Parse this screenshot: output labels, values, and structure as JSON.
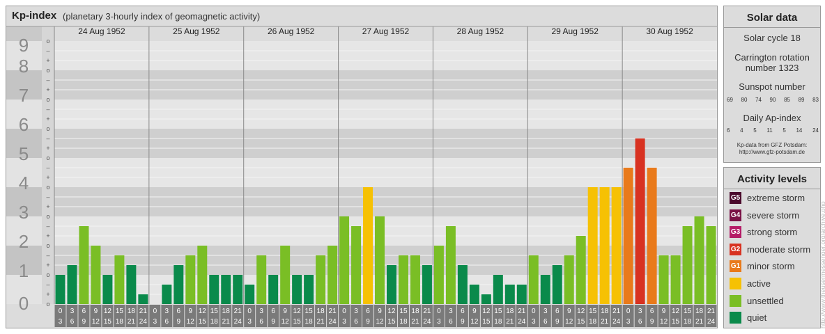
{
  "header": {
    "title": "Kp-index",
    "subtitle": "(planetary 3-hourly index of geomagnetic activity)"
  },
  "chart_data": {
    "type": "bar",
    "title": "Kp-index",
    "subtitle": "(planetary 3-hourly index of geomagnetic activity)",
    "ylim": [
      0,
      9
    ],
    "y_ticks": [
      "0",
      "1",
      "2",
      "3",
      "4",
      "5",
      "6",
      "7",
      "8",
      "9"
    ],
    "minor_tick_labels": [
      "o",
      "+",
      "–"
    ],
    "days": [
      "24 Aug 1952",
      "25 Aug 1952",
      "26 Aug 1952",
      "27 Aug 1952",
      "28 Aug 1952",
      "29 Aug 1952",
      "30 Aug 1952"
    ],
    "interval_labels": [
      [
        "0",
        "3"
      ],
      [
        "3",
        "6"
      ],
      [
        "6",
        "9"
      ],
      [
        "9",
        "12"
      ],
      [
        "12",
        "15"
      ],
      [
        "15",
        "18"
      ],
      [
        "18",
        "21"
      ],
      [
        "21",
        "24"
      ]
    ],
    "values": [
      [
        1.0,
        1.333,
        2.667,
        2.0,
        1.0,
        1.667,
        1.333,
        0.333
      ],
      [
        0.0,
        0.667,
        1.333,
        1.667,
        2.0,
        1.0,
        1.0,
        1.0
      ],
      [
        0.667,
        1.667,
        1.0,
        2.0,
        1.0,
        1.0,
        1.667,
        2.0
      ],
      [
        3.0,
        2.667,
        4.0,
        3.0,
        1.333,
        1.667,
        1.667,
        1.333
      ],
      [
        2.0,
        2.667,
        1.333,
        0.667,
        0.333,
        1.0,
        0.667,
        0.667
      ],
      [
        1.667,
        1.0,
        1.333,
        1.667,
        2.333,
        4.0,
        4.0,
        4.0
      ],
      [
        4.667,
        5.667,
        4.667,
        1.667,
        1.667,
        2.667,
        3.0,
        2.667
      ]
    ],
    "level_colors": {
      "quiet": "#0a8a4b",
      "unsettled": "#7abe25",
      "active": "#f6c104",
      "G1": "#e97a1b",
      "G2": "#d83221",
      "G3": "#b51c67",
      "G4": "#7a1246",
      "G5": "#4b0a2c"
    },
    "grid": true
  },
  "solar": {
    "title": "Solar data",
    "cycle": "Solar cycle 18",
    "carrington_1": "Carrington rotation",
    "carrington_2": "number 1323",
    "sunspot_title": "Sunspot number",
    "sunspot_values": [
      "69",
      "80",
      "74",
      "90",
      "85",
      "89",
      "83"
    ],
    "ap_title": "Daily Ap-index",
    "ap_values": [
      "6",
      "4",
      "5",
      "11",
      "5",
      "14",
      "24"
    ],
    "source_1": "Kp-data from GFZ Potsdam:",
    "source_2": "http://www.gfz-potsdam.de"
  },
  "activity": {
    "title": "Activity levels",
    "levels": [
      {
        "code": "G5",
        "label": "extreme storm",
        "color": "#4b0a2c"
      },
      {
        "code": "G4",
        "label": "severe storm",
        "color": "#7a1246"
      },
      {
        "code": "G3",
        "label": "strong storm",
        "color": "#b51c67"
      },
      {
        "code": "G2",
        "label": "moderate storm",
        "color": "#d83221"
      },
      {
        "code": "G1",
        "label": "minor storm",
        "color": "#e97a1b"
      },
      {
        "code": "",
        "label": "active",
        "color": "#f6c104"
      },
      {
        "code": "",
        "label": "unsettled",
        "color": "#7abe25"
      },
      {
        "code": "",
        "label": "quiet",
        "color": "#0a8a4b"
      }
    ]
  },
  "watermark": "http://www.theusermessenger.org/archive.php"
}
